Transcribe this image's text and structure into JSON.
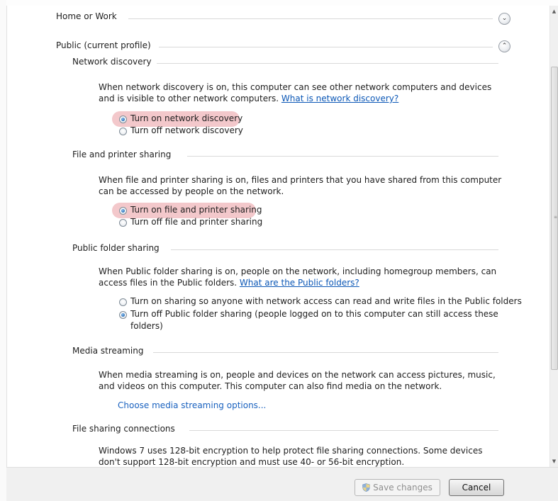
{
  "groups": {
    "home_work": {
      "title": "Home or Work",
      "toggle_glyph": "⌄"
    },
    "public": {
      "title": "Public (current profile)",
      "toggle_glyph": "⌃"
    }
  },
  "sections": {
    "network_discovery": {
      "title": "Network discovery",
      "description": "When network discovery is on, this computer can see other network computers and devices and is visible to other network computers.",
      "link": "What is network discovery?",
      "options": [
        {
          "label": "Turn on network discovery",
          "checked": true
        },
        {
          "label": "Turn off network discovery",
          "checked": false
        }
      ]
    },
    "file_printer_sharing": {
      "title": "File and printer sharing",
      "description": "When file and printer sharing is on, files and printers that you have shared from this computer can be accessed by people on the network.",
      "options": [
        {
          "label": "Turn on file and printer sharing",
          "checked": true
        },
        {
          "label": "Turn off file and printer sharing",
          "checked": false
        }
      ]
    },
    "public_folder_sharing": {
      "title": "Public folder sharing",
      "description": "When Public folder sharing is on, people on the network, including homegroup members, can access files in the Public folders.",
      "link": "What are the Public folders?",
      "options": [
        {
          "label": "Turn on sharing so anyone with network access can read and write files in the Public folders",
          "checked": false
        },
        {
          "label_line1": "Turn off Public folder sharing (people logged on to this computer can still access these",
          "label_line2": "folders)",
          "checked": true
        }
      ]
    },
    "media_streaming": {
      "title": "Media streaming",
      "description": "When media streaming is on, people and devices on the network can access pictures, music, and videos on this computer. This computer can also find media on the network.",
      "link": "Choose media streaming options..."
    },
    "file_sharing_connections": {
      "title": "File sharing connections",
      "description": "Windows 7 uses 128-bit encryption to help protect file sharing connections. Some devices don't support 128-bit encryption and must use 40- or 56-bit encryption."
    }
  },
  "footer": {
    "save_label": "Save changes",
    "cancel_label": "Cancel"
  },
  "colors": {
    "link": "#0b57b6",
    "highlight": "#f3c8cb",
    "shield_blue": "#2f6cc0",
    "shield_yellow": "#f2c230"
  },
  "icons": [
    "chevron-down-icon",
    "chevron-up-icon",
    "shield-icon",
    "scroll-up-arrow-icon",
    "scroll-down-arrow-icon"
  ]
}
